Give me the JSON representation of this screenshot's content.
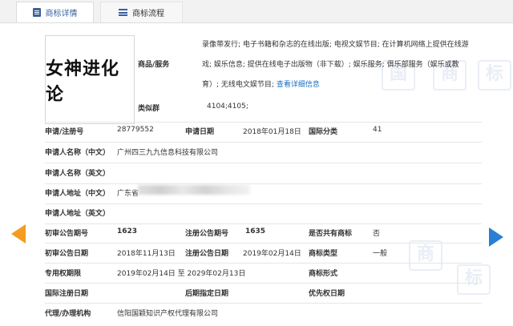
{
  "tabs": [
    {
      "label": "商标详情",
      "icon": "document-icon"
    },
    {
      "label": "商标流程",
      "icon": "list-icon"
    }
  ],
  "mark_name": "女神进化论",
  "goods_services": {
    "label": "商品/服务",
    "lines": [
      "录像带发行; 电子书籍和杂志的在线出版; 电视文娱节目; 在计算机网络上提供在线游",
      "戏; 娱乐信息; 提供在线电子出版物（非下载）; 娱乐服务; 俱乐部服务（娱乐或教",
      "育）; 无线电文娱节目;"
    ],
    "link": "查看详细信息"
  },
  "similar_group": {
    "label": "类似群",
    "value": "4104;4105;"
  },
  "fields": {
    "reg_no_label": "申请/注册号",
    "reg_no": "28779552",
    "apply_date_label": "申请日期",
    "apply_date": "2018年01月18日",
    "intl_class_label": "国际分类",
    "intl_class": "41",
    "applicant_cn_label": "申请人名称（中文）",
    "applicant_cn": "广州四三九九信息科技有限公司",
    "applicant_en_label": "申请人名称（英文）",
    "applicant_en": "",
    "address_cn_label": "申请人地址（中文）",
    "address_cn": "广东省",
    "address_en_label": "申请人地址（英文）",
    "address_en": "",
    "prelim_no_label": "初审公告期号",
    "prelim_no": "1623",
    "reg_pub_no_label": "注册公告期号",
    "reg_pub_no": "1635",
    "shared_label": "是否共有商标",
    "shared": "否",
    "prelim_date_label": "初审公告日期",
    "prelim_date": "2018年11月13日",
    "reg_pub_date_label": "注册公告日期",
    "reg_pub_date": "2019年02月14日",
    "mark_type_label": "商标类型",
    "mark_type": "一般",
    "excl_period_label": "专用权期限",
    "excl_period": "2019年02月14日 至 2029年02月13日",
    "mark_form_label": "商标形式",
    "mark_form": "",
    "intl_reg_date_label": "国际注册日期",
    "intl_reg_date": "",
    "late_date_label": "后期指定日期",
    "late_date": "",
    "priority_date_label": "优先权日期",
    "priority_date": "",
    "agent_label": "代理/办理机构",
    "agent": "信阳国颖知识产权代理有限公司"
  },
  "watermark_chars": [
    "国",
    "商",
    "标"
  ]
}
